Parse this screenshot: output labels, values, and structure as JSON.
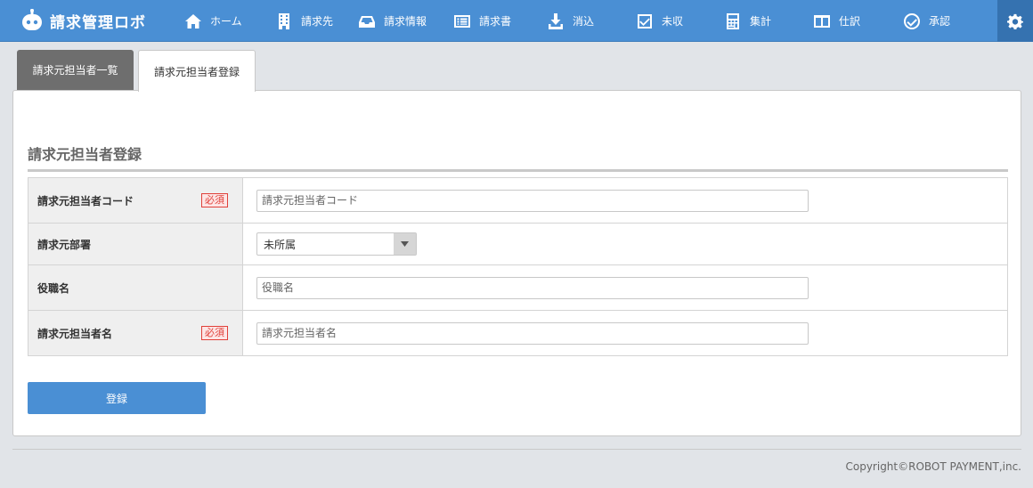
{
  "app": {
    "name": "請求管理ロボ"
  },
  "nav": [
    {
      "label": "ホーム",
      "icon": "home-icon"
    },
    {
      "label": "請求先",
      "icon": "building-icon"
    },
    {
      "label": "請求情報",
      "icon": "inbox-icon"
    },
    {
      "label": "請求書",
      "icon": "list-icon"
    },
    {
      "label": "消込",
      "icon": "download-icon"
    },
    {
      "label": "未収",
      "icon": "checkbox-icon"
    },
    {
      "label": "集計",
      "icon": "calculator-icon"
    },
    {
      "label": "仕訳",
      "icon": "columns-icon"
    },
    {
      "label": "承認",
      "icon": "check-circle-icon"
    }
  ],
  "tabs": [
    {
      "label": "請求元担当者一覧",
      "active": false
    },
    {
      "label": "請求元担当者登録",
      "active": true
    }
  ],
  "form": {
    "title": "請求元担当者登録",
    "required_label": "必須",
    "fields": [
      {
        "label": "請求元担当者コード",
        "required": true,
        "placeholder": "請求元担当者コード",
        "value": ""
      },
      {
        "label": "請求元部署",
        "required": false,
        "selected": "未所属"
      },
      {
        "label": "役職名",
        "required": false,
        "placeholder": "役職名",
        "value": ""
      },
      {
        "label": "請求元担当者名",
        "required": true,
        "placeholder": "請求元担当者名",
        "value": ""
      }
    ],
    "submit_label": "登録"
  },
  "footer": {
    "copyright": "Copyright©ROBOT PAYMENT,inc."
  },
  "colors": {
    "header": "#4a8fd4",
    "settings_bg": "#3572b0",
    "tab_inactive": "#6e6e6e",
    "required": "#e0413a",
    "button": "#4a8fd4"
  }
}
